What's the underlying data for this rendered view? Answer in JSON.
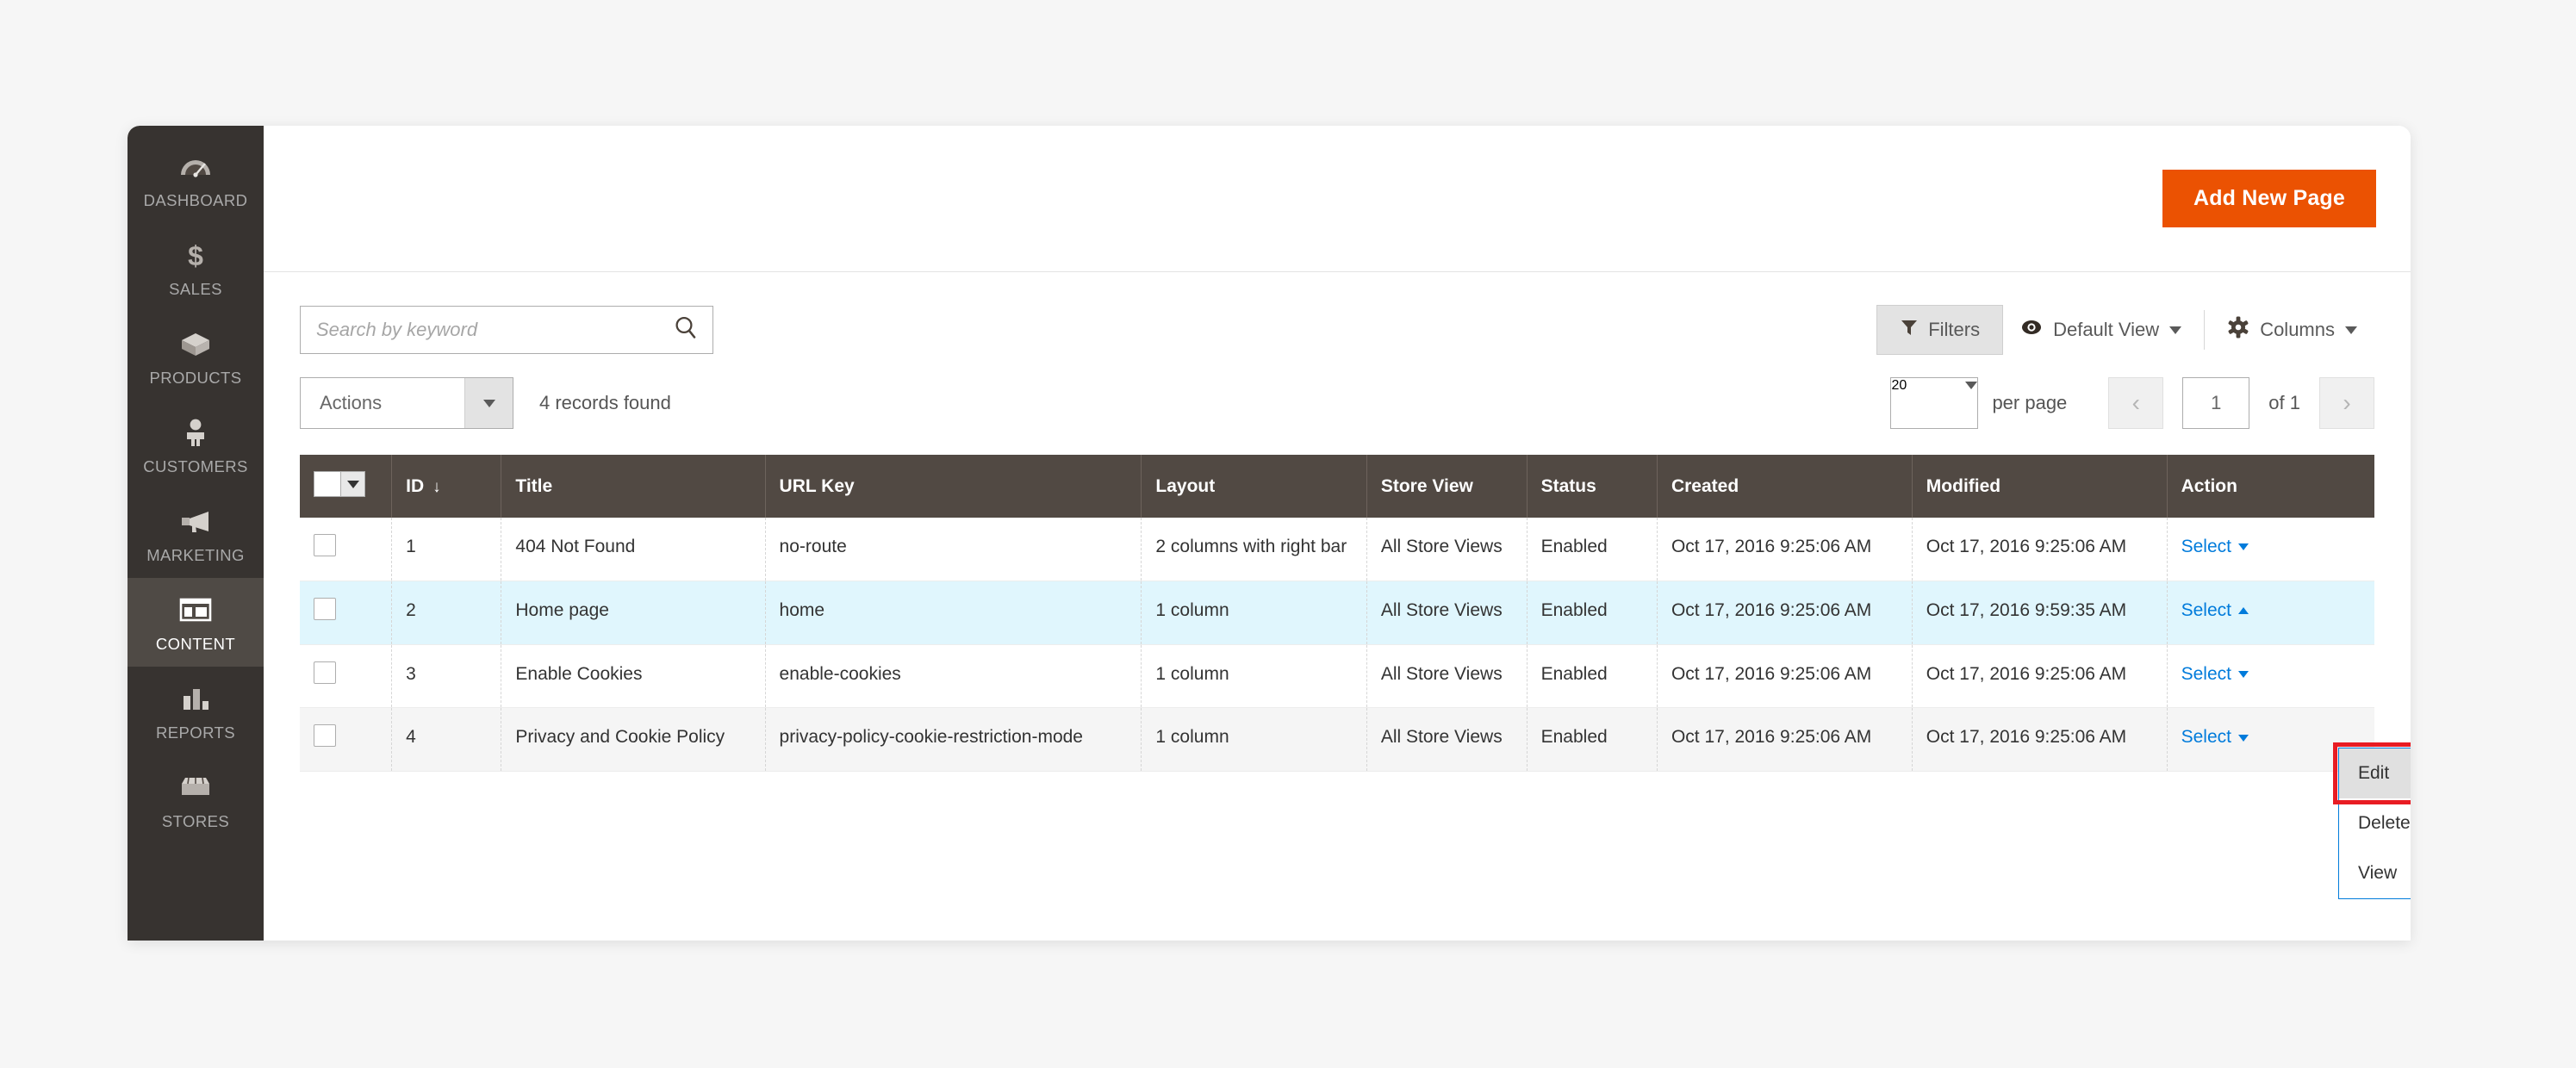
{
  "sidebar": {
    "items": [
      {
        "label": "DASHBOARD",
        "icon": "dashboard-gauge-icon",
        "active": false
      },
      {
        "label": "SALES",
        "icon": "dollar-sign-icon",
        "active": false
      },
      {
        "label": "PRODUCTS",
        "icon": "box-icon",
        "active": false
      },
      {
        "label": "CUSTOMERS",
        "icon": "person-icon",
        "active": false
      },
      {
        "label": "MARKETING",
        "icon": "megaphone-icon",
        "active": false
      },
      {
        "label": "CONTENT",
        "icon": "layout-blocks-icon",
        "active": true
      },
      {
        "label": "REPORTS",
        "icon": "bar-chart-icon",
        "active": false
      },
      {
        "label": "STORES",
        "icon": "storefront-icon",
        "active": false
      }
    ]
  },
  "page_actions": {
    "add_new_page_label": "Add New Page"
  },
  "toolbar": {
    "search_placeholder": "Search by keyword",
    "search_value": "",
    "filters_label": "Filters",
    "view_label": "Default View",
    "columns_label": "Columns"
  },
  "toolbar2": {
    "actions_label": "Actions",
    "records_found": "4 records found",
    "per_page_value": "20",
    "per_page_label": "per page",
    "prev_label": "‹",
    "next_label": "›",
    "page_value": "1",
    "of_label": "of 1"
  },
  "grid": {
    "columns": [
      {
        "key": "checkbox",
        "label": ""
      },
      {
        "key": "id",
        "label": "ID",
        "sort": "↓"
      },
      {
        "key": "title",
        "label": "Title"
      },
      {
        "key": "url_key",
        "label": "URL Key"
      },
      {
        "key": "layout",
        "label": "Layout"
      },
      {
        "key": "store_view",
        "label": "Store View"
      },
      {
        "key": "status",
        "label": "Status"
      },
      {
        "key": "created",
        "label": "Created"
      },
      {
        "key": "modified",
        "label": "Modified"
      },
      {
        "key": "action",
        "label": "Action"
      }
    ],
    "rows": [
      {
        "id": "1",
        "title": "404 Not Found",
        "url_key": "no-route",
        "layout": "2 columns with right bar",
        "store_view": "All Store Views",
        "status": "Enabled",
        "created": "Oct 17, 2016 9:25:06 AM",
        "modified": "Oct 17, 2016 9:25:06 AM",
        "action": "Select"
      },
      {
        "id": "2",
        "title": "Home page",
        "url_key": "home",
        "layout": "1 column",
        "store_view": "All Store Views",
        "status": "Enabled",
        "created": "Oct 17, 2016 9:25:06 AM",
        "modified": "Oct 17, 2016 9:59:35 AM",
        "action": "Select"
      },
      {
        "id": "3",
        "title": "Enable Cookies",
        "url_key": "enable-cookies",
        "layout": "1 column",
        "store_view": "All Store Views",
        "status": "Enabled",
        "created": "Oct 17, 2016 9:25:06 AM",
        "modified": "Oct 17, 2016 9:25:06 AM",
        "action": "Select"
      },
      {
        "id": "4",
        "title": "Privacy and Cookie Policy",
        "url_key": "privacy-policy-cookie-restriction-mode",
        "layout": "1 column",
        "store_view": "All Store Views",
        "status": "Enabled",
        "created": "Oct 17, 2016 9:25:06 AM",
        "modified": "Oct 17, 2016 9:25:06 AM",
        "action": "Select"
      }
    ]
  },
  "action_menu": {
    "open_for_row_id": "2",
    "items": [
      {
        "label": "Edit",
        "hovered": true
      },
      {
        "label": "Delete",
        "hovered": false
      },
      {
        "label": "View",
        "hovered": false
      }
    ]
  },
  "colors": {
    "accent_orange": "#eb5202",
    "sidebar_bg": "#373330",
    "table_header_bg": "#514943",
    "selected_row_bg": "#e0f6fd",
    "link_blue": "#007bdb",
    "highlight_red": "#e81c23"
  }
}
